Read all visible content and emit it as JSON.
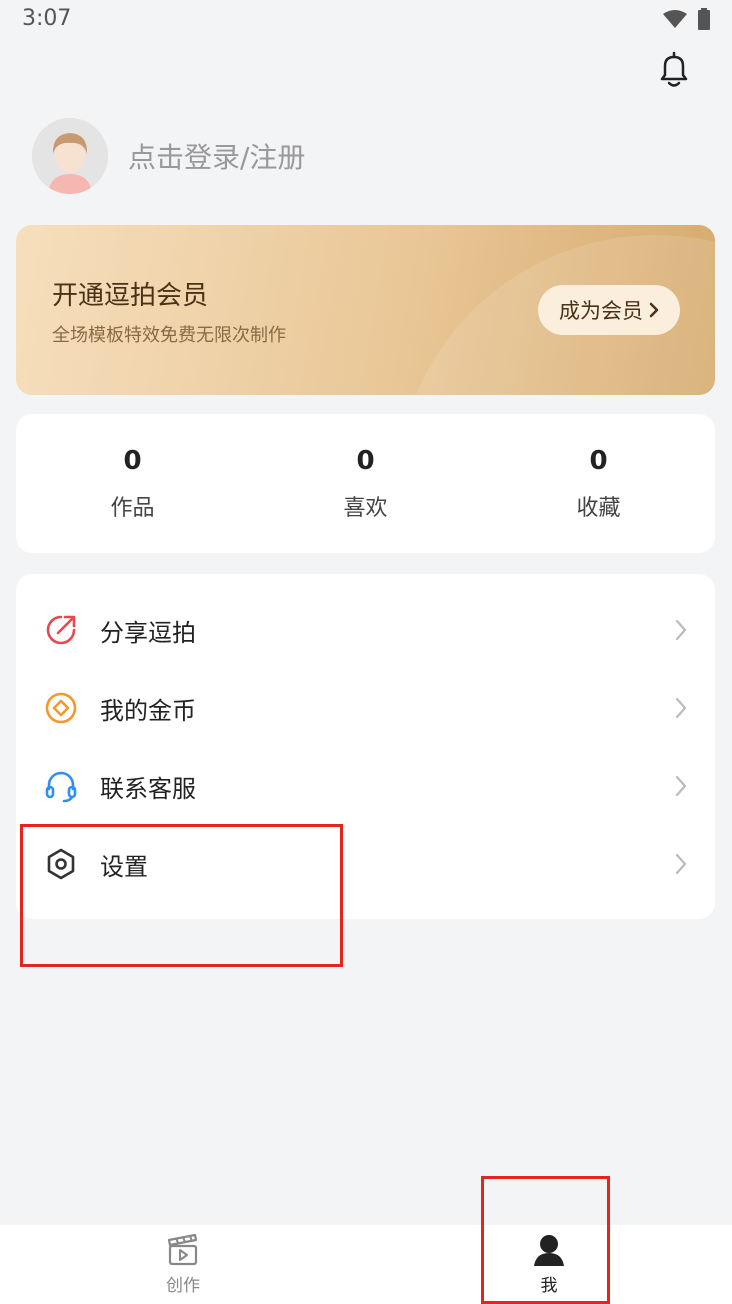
{
  "status": {
    "time": "3:07"
  },
  "profile": {
    "login_text": "点击登录/注册"
  },
  "vip": {
    "title": "开通逗拍会员",
    "subtitle": "全场模板特效免费无限次制作",
    "button": "成为会员"
  },
  "stats": [
    {
      "value": "0",
      "label": "作品"
    },
    {
      "value": "0",
      "label": "喜欢"
    },
    {
      "value": "0",
      "label": "收藏"
    }
  ],
  "menu": [
    {
      "label": "分享逗拍",
      "icon": "share-icon",
      "color": "#e8474f"
    },
    {
      "label": "我的金币",
      "icon": "coin-icon",
      "color": "#f5972a"
    },
    {
      "label": "联系客服",
      "icon": "headset-icon",
      "color": "#2f8ef0"
    },
    {
      "label": "设置",
      "icon": "settings-icon",
      "color": "#333333"
    }
  ],
  "tabs": [
    {
      "label": "创作",
      "icon": "clapperboard-icon",
      "active": false
    },
    {
      "label": "我",
      "icon": "person-icon",
      "active": true
    }
  ],
  "colors": {
    "highlight": "#e5231f",
    "background": "#f3f4f6"
  }
}
